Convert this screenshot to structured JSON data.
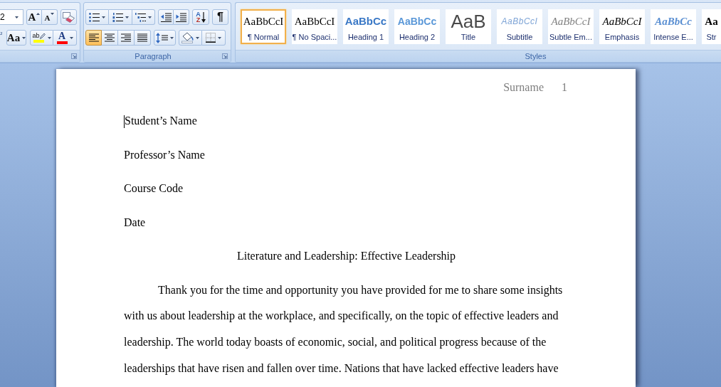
{
  "ribbon": {
    "font_group": {
      "font_size": "2",
      "grow_font": "A",
      "shrink_font": "A",
      "superscript": "²",
      "change_case": "Aa",
      "highlight": "ab",
      "font_color": "A"
    },
    "paragraph_group": {
      "label": "Paragraph",
      "alignments": [
        {
          "kind": "left",
          "selected": true
        },
        {
          "kind": "center",
          "selected": false
        },
        {
          "kind": "right",
          "selected": false
        },
        {
          "kind": "justify",
          "selected": false
        }
      ],
      "sort": [
        "A",
        "Z"
      ],
      "show_marks": "¶"
    },
    "styles_group": {
      "label": "Styles",
      "items": [
        {
          "kind": "normal",
          "preview": "AaBbCcI",
          "name": "¶ Normal",
          "selected": true
        },
        {
          "kind": "no_spacing",
          "preview": "AaBbCcI",
          "name": "¶ No Spaci...",
          "selected": false
        },
        {
          "kind": "heading1",
          "preview": "AaBbCc",
          "name": "Heading 1",
          "selected": false
        },
        {
          "kind": "heading2",
          "preview": "AaBbCc",
          "name": "Heading 2",
          "selected": false
        },
        {
          "kind": "title",
          "preview": "AaB",
          "name": "Title",
          "selected": false
        },
        {
          "kind": "subtitle",
          "preview": "AaBbCcI",
          "name": "Subtitle",
          "selected": false
        },
        {
          "kind": "subtle_emphasis",
          "preview": "AaBbCcI",
          "name": "Subtle Em...",
          "selected": false
        },
        {
          "kind": "emphasis",
          "preview": "AaBbCcI",
          "name": "Emphasis",
          "selected": false
        },
        {
          "kind": "intense_emphasis",
          "preview": "AaBbCc",
          "name": "Intense E...",
          "selected": false
        },
        {
          "kind": "strong",
          "preview": "Aa",
          "name": "Str",
          "selected": false
        }
      ]
    }
  },
  "document": {
    "header": {
      "running_head": "Surname",
      "page_number": "1"
    },
    "lines": [
      {
        "text": "Student’s Name",
        "cursor": true
      },
      {
        "text": "Professor’s Name",
        "cursor": false
      },
      {
        "text": "Course Code",
        "cursor": false
      },
      {
        "text": "Date",
        "cursor": false
      }
    ],
    "title": "Literature and Leadership: Effective Leadership",
    "paragraph": "Thank you for the time and opportunity you have provided for me to share some insights with us about leadership at the workplace, and specifically, on the topic of effective leaders and leadership. The world today boasts of economic, social, and political progress because of the leaderships that have risen and fallen over time. Nations that have lacked effective leaders have"
  }
}
